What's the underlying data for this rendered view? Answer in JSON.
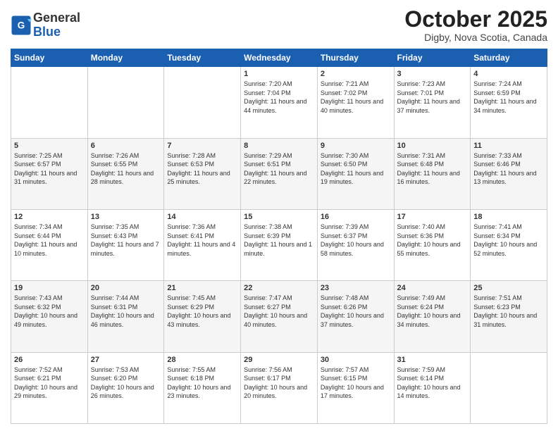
{
  "header": {
    "logo_line1": "General",
    "logo_line2": "Blue",
    "month": "October 2025",
    "location": "Digby, Nova Scotia, Canada"
  },
  "days_of_week": [
    "Sunday",
    "Monday",
    "Tuesday",
    "Wednesday",
    "Thursday",
    "Friday",
    "Saturday"
  ],
  "weeks": [
    [
      {
        "day": "",
        "info": ""
      },
      {
        "day": "",
        "info": ""
      },
      {
        "day": "",
        "info": ""
      },
      {
        "day": "1",
        "info": "Sunrise: 7:20 AM\nSunset: 7:04 PM\nDaylight: 11 hours\nand 44 minutes."
      },
      {
        "day": "2",
        "info": "Sunrise: 7:21 AM\nSunset: 7:02 PM\nDaylight: 11 hours\nand 40 minutes."
      },
      {
        "day": "3",
        "info": "Sunrise: 7:23 AM\nSunset: 7:01 PM\nDaylight: 11 hours\nand 37 minutes."
      },
      {
        "day": "4",
        "info": "Sunrise: 7:24 AM\nSunset: 6:59 PM\nDaylight: 11 hours\nand 34 minutes."
      }
    ],
    [
      {
        "day": "5",
        "info": "Sunrise: 7:25 AM\nSunset: 6:57 PM\nDaylight: 11 hours\nand 31 minutes."
      },
      {
        "day": "6",
        "info": "Sunrise: 7:26 AM\nSunset: 6:55 PM\nDaylight: 11 hours\nand 28 minutes."
      },
      {
        "day": "7",
        "info": "Sunrise: 7:28 AM\nSunset: 6:53 PM\nDaylight: 11 hours\nand 25 minutes."
      },
      {
        "day": "8",
        "info": "Sunrise: 7:29 AM\nSunset: 6:51 PM\nDaylight: 11 hours\nand 22 minutes."
      },
      {
        "day": "9",
        "info": "Sunrise: 7:30 AM\nSunset: 6:50 PM\nDaylight: 11 hours\nand 19 minutes."
      },
      {
        "day": "10",
        "info": "Sunrise: 7:31 AM\nSunset: 6:48 PM\nDaylight: 11 hours\nand 16 minutes."
      },
      {
        "day": "11",
        "info": "Sunrise: 7:33 AM\nSunset: 6:46 PM\nDaylight: 11 hours\nand 13 minutes."
      }
    ],
    [
      {
        "day": "12",
        "info": "Sunrise: 7:34 AM\nSunset: 6:44 PM\nDaylight: 11 hours\nand 10 minutes."
      },
      {
        "day": "13",
        "info": "Sunrise: 7:35 AM\nSunset: 6:43 PM\nDaylight: 11 hours\nand 7 minutes."
      },
      {
        "day": "14",
        "info": "Sunrise: 7:36 AM\nSunset: 6:41 PM\nDaylight: 11 hours\nand 4 minutes."
      },
      {
        "day": "15",
        "info": "Sunrise: 7:38 AM\nSunset: 6:39 PM\nDaylight: 11 hours\nand 1 minute."
      },
      {
        "day": "16",
        "info": "Sunrise: 7:39 AM\nSunset: 6:37 PM\nDaylight: 10 hours\nand 58 minutes."
      },
      {
        "day": "17",
        "info": "Sunrise: 7:40 AM\nSunset: 6:36 PM\nDaylight: 10 hours\nand 55 minutes."
      },
      {
        "day": "18",
        "info": "Sunrise: 7:41 AM\nSunset: 6:34 PM\nDaylight: 10 hours\nand 52 minutes."
      }
    ],
    [
      {
        "day": "19",
        "info": "Sunrise: 7:43 AM\nSunset: 6:32 PM\nDaylight: 10 hours\nand 49 minutes."
      },
      {
        "day": "20",
        "info": "Sunrise: 7:44 AM\nSunset: 6:31 PM\nDaylight: 10 hours\nand 46 minutes."
      },
      {
        "day": "21",
        "info": "Sunrise: 7:45 AM\nSunset: 6:29 PM\nDaylight: 10 hours\nand 43 minutes."
      },
      {
        "day": "22",
        "info": "Sunrise: 7:47 AM\nSunset: 6:27 PM\nDaylight: 10 hours\nand 40 minutes."
      },
      {
        "day": "23",
        "info": "Sunrise: 7:48 AM\nSunset: 6:26 PM\nDaylight: 10 hours\nand 37 minutes."
      },
      {
        "day": "24",
        "info": "Sunrise: 7:49 AM\nSunset: 6:24 PM\nDaylight: 10 hours\nand 34 minutes."
      },
      {
        "day": "25",
        "info": "Sunrise: 7:51 AM\nSunset: 6:23 PM\nDaylight: 10 hours\nand 31 minutes."
      }
    ],
    [
      {
        "day": "26",
        "info": "Sunrise: 7:52 AM\nSunset: 6:21 PM\nDaylight: 10 hours\nand 29 minutes."
      },
      {
        "day": "27",
        "info": "Sunrise: 7:53 AM\nSunset: 6:20 PM\nDaylight: 10 hours\nand 26 minutes."
      },
      {
        "day": "28",
        "info": "Sunrise: 7:55 AM\nSunset: 6:18 PM\nDaylight: 10 hours\nand 23 minutes."
      },
      {
        "day": "29",
        "info": "Sunrise: 7:56 AM\nSunset: 6:17 PM\nDaylight: 10 hours\nand 20 minutes."
      },
      {
        "day": "30",
        "info": "Sunrise: 7:57 AM\nSunset: 6:15 PM\nDaylight: 10 hours\nand 17 minutes."
      },
      {
        "day": "31",
        "info": "Sunrise: 7:59 AM\nSunset: 6:14 PM\nDaylight: 10 hours\nand 14 minutes."
      },
      {
        "day": "",
        "info": ""
      }
    ]
  ]
}
